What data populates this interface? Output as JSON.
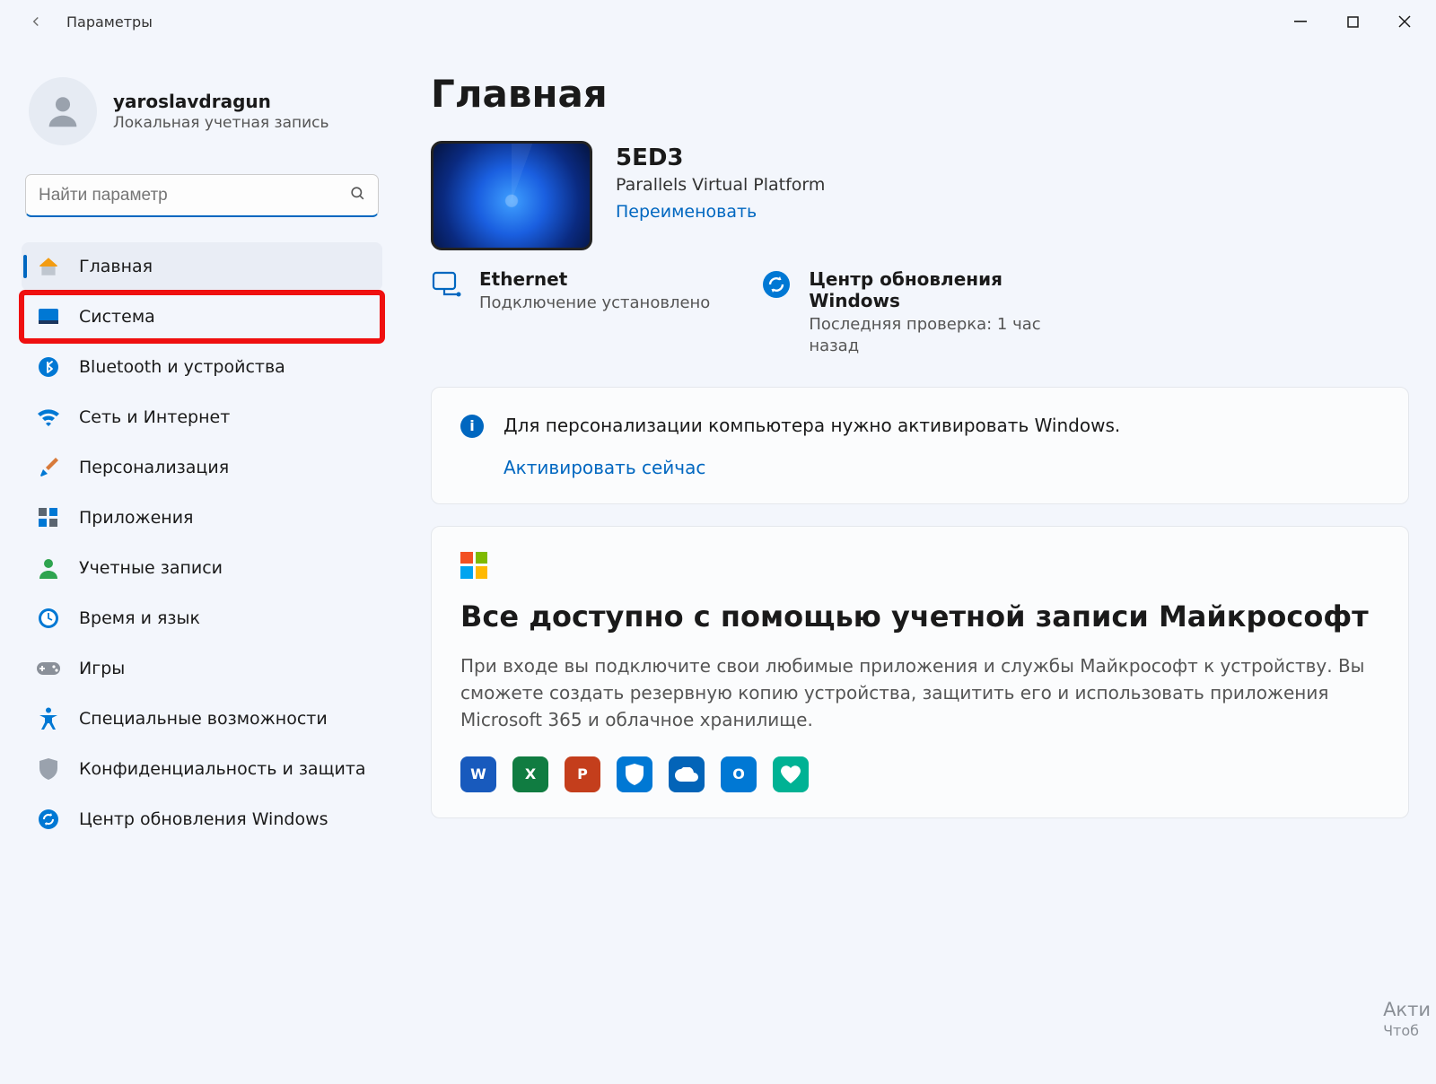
{
  "titlebar": {
    "app_title": "Параметры"
  },
  "profile": {
    "name": "yaroslavdragun",
    "subtitle": "Локальная учетная запись"
  },
  "search": {
    "placeholder": "Найти параметр"
  },
  "nav": [
    {
      "key": "home",
      "label": "Главная"
    },
    {
      "key": "system",
      "label": "Система"
    },
    {
      "key": "bluetooth",
      "label": "Bluetooth и устройства"
    },
    {
      "key": "network",
      "label": "Сеть и Интернет"
    },
    {
      "key": "personal",
      "label": "Персонализация"
    },
    {
      "key": "apps",
      "label": "Приложения"
    },
    {
      "key": "accounts",
      "label": "Учетные записи"
    },
    {
      "key": "timelang",
      "label": "Время и язык"
    },
    {
      "key": "gaming",
      "label": "Игры"
    },
    {
      "key": "access",
      "label": "Специальные возможности"
    },
    {
      "key": "privacy",
      "label": "Конфиденциальность и защита"
    },
    {
      "key": "update",
      "label": "Центр обновления Windows"
    }
  ],
  "page": {
    "title": "Главная"
  },
  "device": {
    "name": "5ED3",
    "platform": "Parallels Virtual Platform",
    "rename": "Переименовать"
  },
  "status": {
    "ethernet": {
      "title": "Ethernet",
      "sub": "Подключение установлено"
    },
    "update": {
      "title": "Центр обновления Windows",
      "sub": "Последняя проверка: 1 час назад"
    }
  },
  "activation": {
    "message": "Для персонализации компьютера нужно активировать Windows.",
    "link": "Активировать сейчас"
  },
  "microsoft": {
    "heading": "Все доступно с помощью учетной записи Майкрософт",
    "body": "При входе вы подключите свои любимые приложения и службы Майкрософт к устройству. Вы сможете создать резервную копию устройства, защитить его и использовать приложения Microsoft 365 и облачное хранилище.",
    "apps": [
      {
        "letter": "W",
        "color": "#185abd",
        "name": "word"
      },
      {
        "letter": "X",
        "color": "#107c41",
        "name": "excel"
      },
      {
        "letter": "P",
        "color": "#c43e1c",
        "name": "powerpoint"
      },
      {
        "letter": "",
        "color": "#0078d4",
        "name": "defender-shield"
      },
      {
        "letter": "",
        "color": "#0364b8",
        "name": "onedrive-cloud"
      },
      {
        "letter": "O",
        "color": "#0078d4",
        "name": "outlook"
      },
      {
        "letter": "",
        "color": "#00b294",
        "name": "family-heart"
      }
    ]
  },
  "watermark": {
    "line1": "Акти",
    "line2": "Чтоб"
  }
}
